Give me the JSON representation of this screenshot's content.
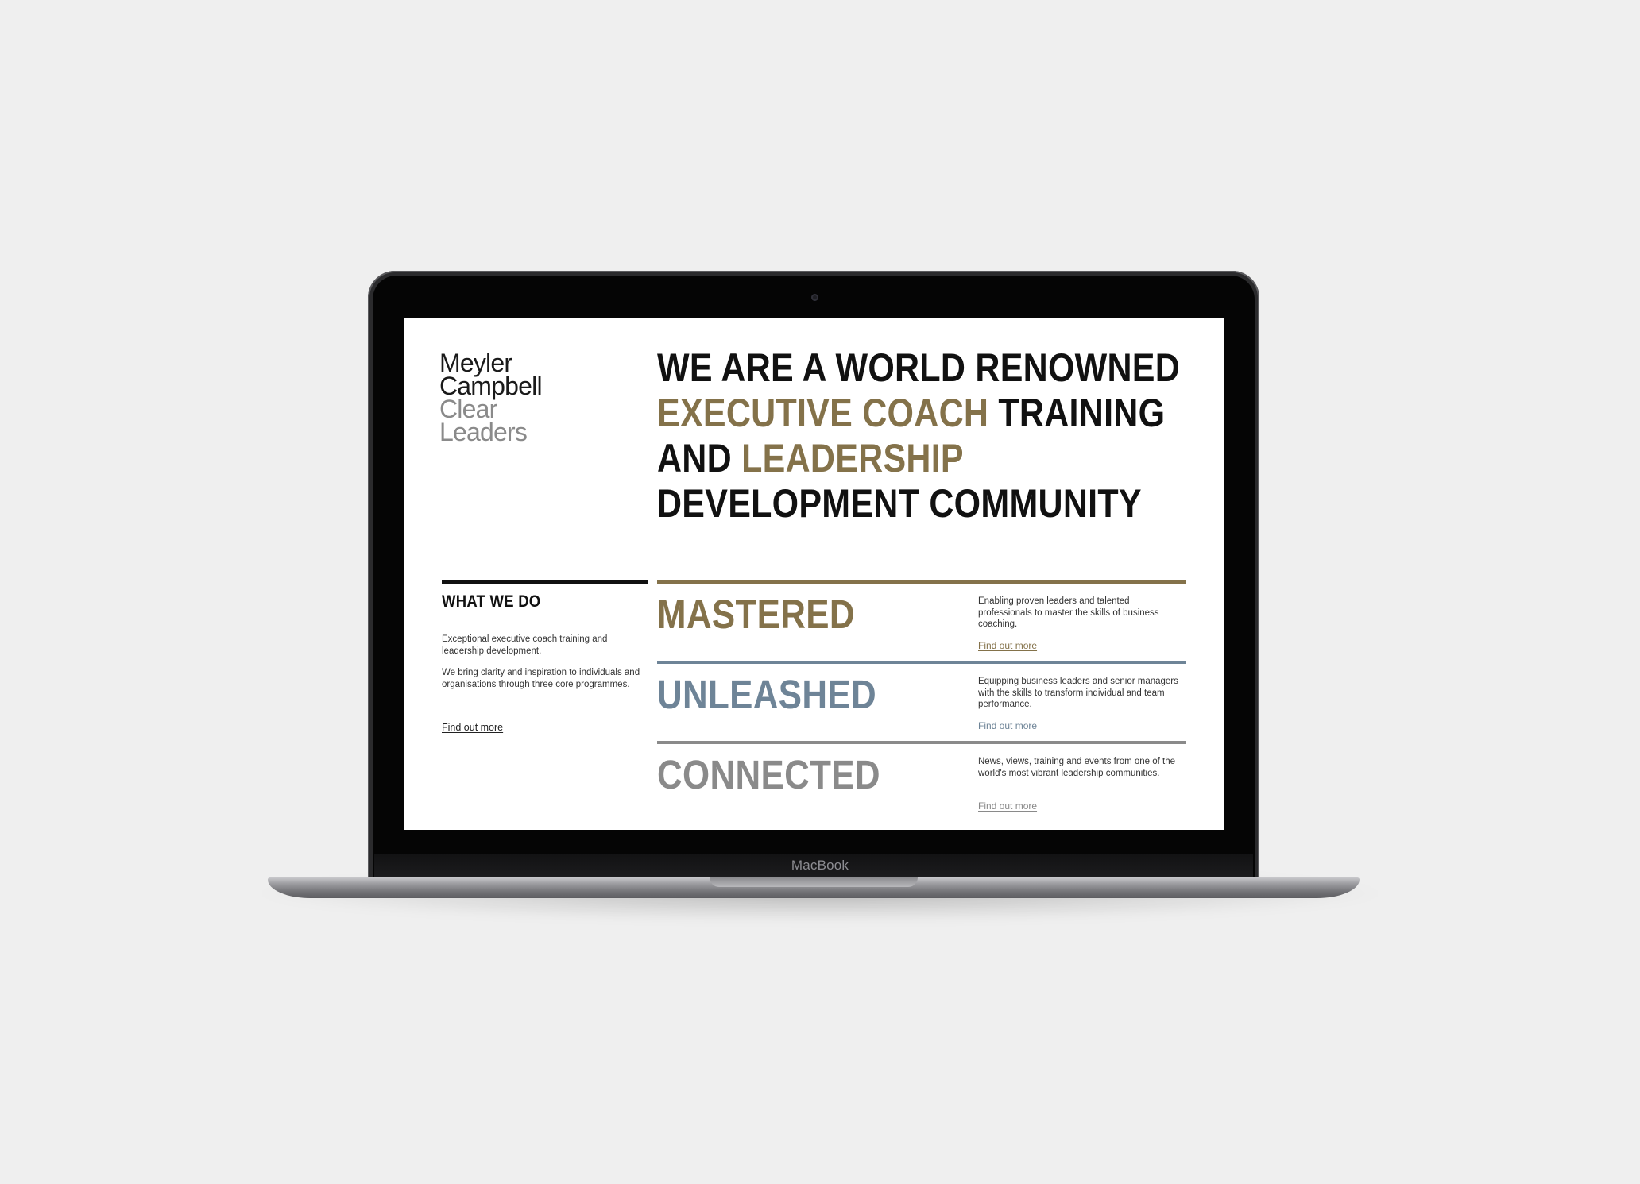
{
  "theme": {
    "gold": "#84724a",
    "slate": "#6e8497",
    "grey": "#8a8a8a",
    "black": "#111111"
  },
  "device": {
    "brand_label": "MacBook"
  },
  "logo": {
    "line1": "Meyler",
    "line2": "Campbell",
    "line3": "Clear",
    "line4": "Leaders"
  },
  "headline": {
    "l1": "WE ARE A WORLD RENOWNED",
    "l2_accent": "EXECUTIVE COACH",
    "l2_rest": " TRAINING",
    "l3_start": "AND ",
    "l3_accent": "LEADERSHIP",
    "l4": "DEVELOPMENT COMMUNITY"
  },
  "what_we_do": {
    "title": "WHAT WE DO",
    "p1": "Exceptional executive coach training and leadership development.",
    "p2": "We bring clarity and inspiration to individuals and organisations through three core programmes.",
    "link": "Find out more"
  },
  "programmes": [
    {
      "title": "MASTERED",
      "color": "#84724a",
      "description": "Enabling proven leaders and talented professionals to master the skills of business coaching.",
      "link": "Find out more"
    },
    {
      "title": "UNLEASHED",
      "color": "#6e8497",
      "description": "Equipping business leaders and senior managers with the skills to transform individual and team performance.",
      "link": "Find out more"
    },
    {
      "title": "CONNECTED",
      "color": "#8a8a8a",
      "description": "News, views, training and events from one of the world's most vibrant leadership communities.",
      "link": "Find out more"
    }
  ]
}
